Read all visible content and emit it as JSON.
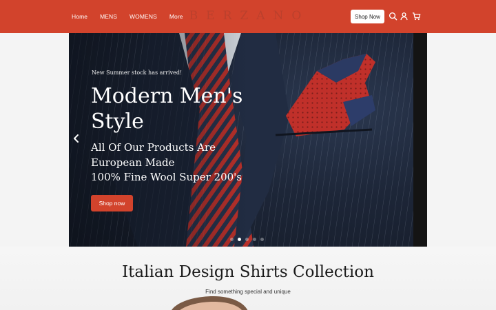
{
  "header": {
    "nav": [
      "Home",
      "MENS",
      "WOMENS",
      "More"
    ],
    "logo": "BERZANO",
    "shop_button": "Shop Now",
    "icons": [
      "search-icon",
      "user-icon",
      "cart-icon"
    ],
    "background": "#d2432c"
  },
  "hero": {
    "kicker": "New Summer stock has arrived!",
    "title_line1": "Modern Men's",
    "title_line2": "Style",
    "subtitle_line1": "All Of Our Products Are",
    "subtitle_line2": "European Made",
    "subtitle_line3": "100% Fine Wool Super 200's",
    "cta": "Shop now",
    "slide_count": 5,
    "active_slide": 2
  },
  "section": {
    "title": "Italian Design Shirts Collection",
    "subtitle": "Find something special and unique"
  },
  "colors": {
    "accent": "#d2432c",
    "suit": "#1d2638",
    "tie_red": "#b8302a"
  }
}
